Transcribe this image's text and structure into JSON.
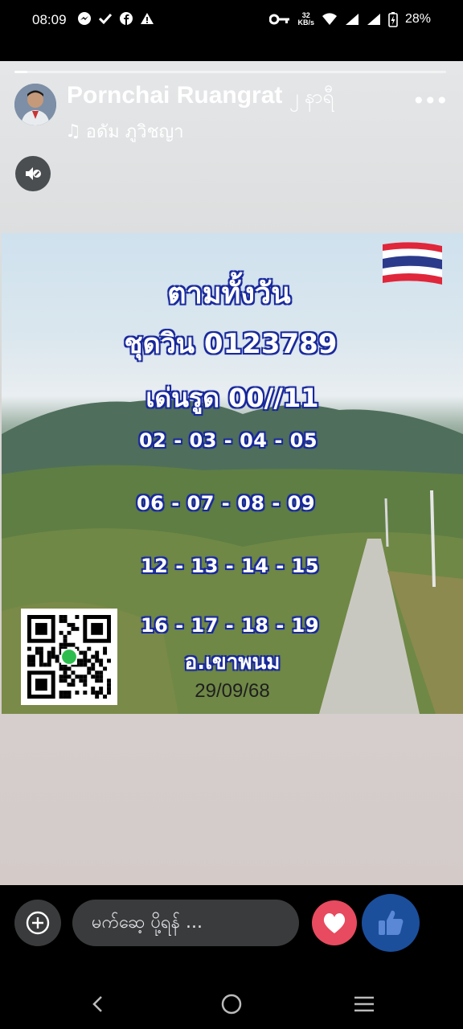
{
  "status_bar": {
    "time": "08:09",
    "network_speed_value": "32",
    "network_speed_unit": "KB/s",
    "battery": "28%",
    "left_icons": [
      "messenger-icon",
      "check-icon",
      "facebook-icon",
      "warning-icon"
    ],
    "right_icons": [
      "key-icon",
      "wifi-icon",
      "signal-icon",
      "signal-icon",
      "battery-charging-icon"
    ]
  },
  "story": {
    "author_name": "Pornchai Ruangrat",
    "time_ago": "၂ နာရီ",
    "music_label": "อดัม ภูวิชญา",
    "progress": 0.03,
    "image": {
      "title": "ตามทั้งวัน",
      "set_line": "ชุดวิน 0123789",
      "star_line": "เด่นรูด 00//11",
      "number_rows": [
        "02 - 03 - 04 - 05",
        "06 - 07 - 08  - 09",
        "12 - 13 - 14 - 15",
        "16 - 17 - 18 - 19"
      ],
      "location": "อ.เขาพนม",
      "date": "29/09/68"
    }
  },
  "reply_bar": {
    "placeholder": "မက်ဆေ့ ပို့ရန် ..."
  },
  "colors": {
    "background": "#000000",
    "text_outline": "#1a2a9c",
    "heart": "#e84a5f",
    "like": "#1b4f9c",
    "input_bg": "#3a3b3c"
  }
}
